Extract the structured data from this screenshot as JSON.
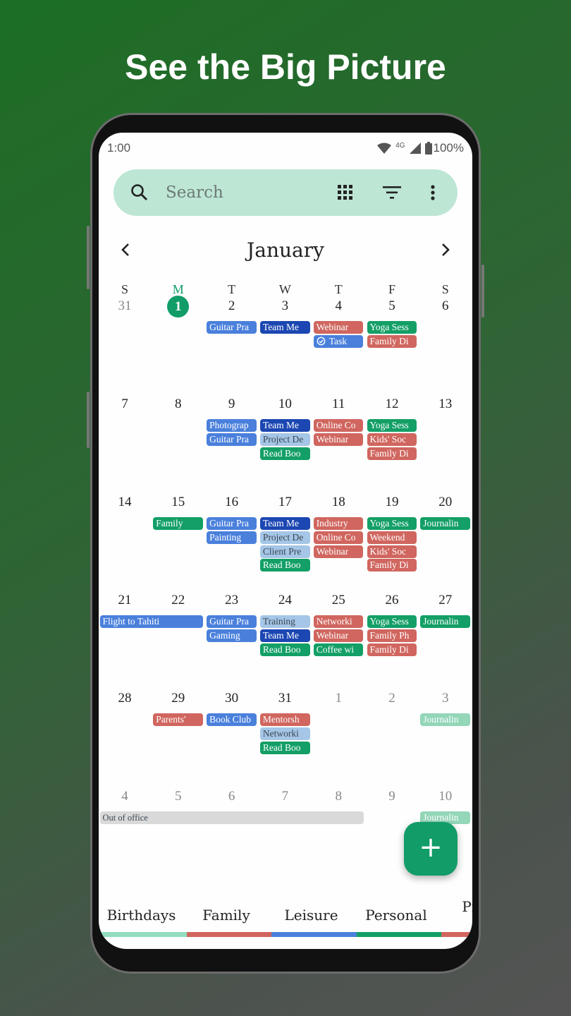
{
  "headline": "See the Big Picture",
  "status": {
    "time": "1:00",
    "network": "4G",
    "battery": "100%"
  },
  "search": {
    "placeholder": "Search",
    "icons": [
      "search-icon",
      "grid-icon",
      "filter-icon",
      "more-vert-icon"
    ]
  },
  "calendar": {
    "month": "January",
    "weekdays": [
      "S",
      "M",
      "T",
      "W",
      "T",
      "F",
      "S"
    ],
    "today_index": 1,
    "colors": {
      "leisure": "#4a80dc",
      "work": "#1c47b2",
      "family": "#d0665f",
      "personal": "#139f66",
      "light": "#a5c6e7",
      "faded": "#93d6b8",
      "gray": "#d9d9d9"
    },
    "weeks": [
      {
        "dates": [
          {
            "n": "31",
            "muted": true
          },
          {
            "n": "1",
            "today": true
          },
          {
            "n": "2"
          },
          {
            "n": "3"
          },
          {
            "n": "4"
          },
          {
            "n": "5"
          },
          {
            "n": "6"
          }
        ],
        "events": [
          {
            "day": 2,
            "slot": 0,
            "label": "Guitar Pra",
            "cal": "leisure"
          },
          {
            "day": 3,
            "slot": 0,
            "label": "Team Me",
            "cal": "work"
          },
          {
            "day": 4,
            "slot": 0,
            "label": "Webinar",
            "cal": "family"
          },
          {
            "day": 4,
            "slot": 1,
            "label": "Task",
            "cal": "leisure",
            "task": true
          },
          {
            "day": 5,
            "slot": 0,
            "label": "Yoga Sess",
            "cal": "personal"
          },
          {
            "day": 5,
            "slot": 1,
            "label": "Family Di",
            "cal": "family"
          }
        ]
      },
      {
        "dates": [
          {
            "n": "7"
          },
          {
            "n": "8"
          },
          {
            "n": "9"
          },
          {
            "n": "10"
          },
          {
            "n": "11"
          },
          {
            "n": "12"
          },
          {
            "n": "13"
          }
        ],
        "events": [
          {
            "day": 2,
            "slot": 0,
            "label": "Photograp",
            "cal": "leisure"
          },
          {
            "day": 2,
            "slot": 1,
            "label": "Guitar Pra",
            "cal": "leisure"
          },
          {
            "day": 3,
            "slot": 0,
            "label": "Team Me",
            "cal": "work"
          },
          {
            "day": 3,
            "slot": 1,
            "label": "Project De",
            "cal": "light"
          },
          {
            "day": 3,
            "slot": 2,
            "label": "Read Boo",
            "cal": "personal"
          },
          {
            "day": 4,
            "slot": 0,
            "label": "Online Co",
            "cal": "family"
          },
          {
            "day": 4,
            "slot": 1,
            "label": "Webinar",
            "cal": "family"
          },
          {
            "day": 5,
            "slot": 0,
            "label": "Yoga Sess",
            "cal": "personal"
          },
          {
            "day": 5,
            "slot": 1,
            "label": "Kids' Soc",
            "cal": "family"
          },
          {
            "day": 5,
            "slot": 2,
            "label": "Family Di",
            "cal": "family"
          }
        ]
      },
      {
        "dates": [
          {
            "n": "14"
          },
          {
            "n": "15"
          },
          {
            "n": "16"
          },
          {
            "n": "17"
          },
          {
            "n": "18"
          },
          {
            "n": "19"
          },
          {
            "n": "20"
          }
        ],
        "events": [
          {
            "day": 1,
            "slot": 0,
            "label": "Family",
            "cal": "personal"
          },
          {
            "day": 2,
            "slot": 0,
            "label": "Guitar Pra",
            "cal": "leisure"
          },
          {
            "day": 2,
            "slot": 1,
            "label": "Painting",
            "cal": "leisure"
          },
          {
            "day": 3,
            "slot": 0,
            "label": "Team Me",
            "cal": "work"
          },
          {
            "day": 3,
            "slot": 1,
            "label": "Project De",
            "cal": "light"
          },
          {
            "day": 3,
            "slot": 2,
            "label": "Client Pre",
            "cal": "light"
          },
          {
            "day": 3,
            "slot": 3,
            "label": "Read Boo",
            "cal": "personal"
          },
          {
            "day": 4,
            "slot": 0,
            "label": "Industry",
            "cal": "family"
          },
          {
            "day": 4,
            "slot": 1,
            "label": "Online Co",
            "cal": "family"
          },
          {
            "day": 4,
            "slot": 2,
            "label": "Webinar",
            "cal": "family"
          },
          {
            "day": 5,
            "slot": 0,
            "label": "Yoga Sess",
            "cal": "personal"
          },
          {
            "day": 5,
            "slot": 1,
            "label": "Weekend",
            "cal": "family"
          },
          {
            "day": 5,
            "slot": 2,
            "label": "Kids' Soc",
            "cal": "family"
          },
          {
            "day": 5,
            "slot": 3,
            "label": "Family Di",
            "cal": "family"
          },
          {
            "day": 6,
            "slot": 0,
            "label": "Journalin",
            "cal": "personal"
          }
        ]
      },
      {
        "dates": [
          {
            "n": "21"
          },
          {
            "n": "22"
          },
          {
            "n": "23"
          },
          {
            "n": "24"
          },
          {
            "n": "25"
          },
          {
            "n": "26"
          },
          {
            "n": "27"
          }
        ],
        "events": [
          {
            "day": 0,
            "span": 2,
            "slot": 0,
            "label": "Flight to Tahiti",
            "cal": "leisure"
          },
          {
            "day": 2,
            "slot": 0,
            "label": "Guitar Pra",
            "cal": "leisure"
          },
          {
            "day": 2,
            "slot": 1,
            "label": "Gaming",
            "cal": "leisure"
          },
          {
            "day": 3,
            "slot": 0,
            "label": "Training",
            "cal": "light"
          },
          {
            "day": 3,
            "slot": 1,
            "label": "Team Me",
            "cal": "work"
          },
          {
            "day": 3,
            "slot": 2,
            "label": "Read Boo",
            "cal": "personal"
          },
          {
            "day": 4,
            "slot": 0,
            "label": "Networki",
            "cal": "family"
          },
          {
            "day": 4,
            "slot": 1,
            "label": "Webinar",
            "cal": "family"
          },
          {
            "day": 4,
            "slot": 2,
            "label": "Coffee wi",
            "cal": "personal"
          },
          {
            "day": 5,
            "slot": 0,
            "label": "Yoga Sess",
            "cal": "personal"
          },
          {
            "day": 5,
            "slot": 1,
            "label": "Family Ph",
            "cal": "family"
          },
          {
            "day": 5,
            "slot": 2,
            "label": "Family Di",
            "cal": "family"
          },
          {
            "day": 6,
            "slot": 0,
            "label": "Journalin",
            "cal": "personal"
          }
        ]
      },
      {
        "dates": [
          {
            "n": "28"
          },
          {
            "n": "29"
          },
          {
            "n": "30"
          },
          {
            "n": "31"
          },
          {
            "n": "1",
            "muted": true
          },
          {
            "n": "2",
            "muted": true
          },
          {
            "n": "3",
            "muted": true
          }
        ],
        "events": [
          {
            "day": 1,
            "slot": 0,
            "label": "Parents'",
            "cal": "family"
          },
          {
            "day": 2,
            "slot": 0,
            "label": "Book Club",
            "cal": "leisure"
          },
          {
            "day": 3,
            "slot": 0,
            "label": "Mentorsh",
            "cal": "family"
          },
          {
            "day": 3,
            "slot": 1,
            "label": "Networki",
            "cal": "light"
          },
          {
            "day": 3,
            "slot": 2,
            "label": "Read Boo",
            "cal": "personal"
          },
          {
            "day": 6,
            "slot": 0,
            "label": "Journalin",
            "cal": "faded"
          }
        ]
      },
      {
        "dates": [
          {
            "n": "4",
            "muted": true
          },
          {
            "n": "5",
            "muted": true
          },
          {
            "n": "6",
            "muted": true
          },
          {
            "n": "7",
            "muted": true
          },
          {
            "n": "8",
            "muted": true
          },
          {
            "n": "9",
            "muted": true
          },
          {
            "n": "10",
            "muted": true
          }
        ],
        "events": [
          {
            "day": 0,
            "span": 5,
            "slot": 0,
            "label": "Out of office",
            "cal": "gray"
          },
          {
            "day": 6,
            "slot": 0,
            "label": "Journalin",
            "cal": "faded"
          }
        ]
      }
    ]
  },
  "fab": {
    "label": "+"
  },
  "tabs": [
    {
      "label": "Birthdays",
      "color": "#93dcbf"
    },
    {
      "label": "Family",
      "color": "#d0665f"
    },
    {
      "label": "Leisure",
      "color": "#4a80dc"
    },
    {
      "label": "Personal",
      "color": "#139f66"
    },
    {
      "label": "Profe",
      "color": "#d0665f"
    }
  ]
}
